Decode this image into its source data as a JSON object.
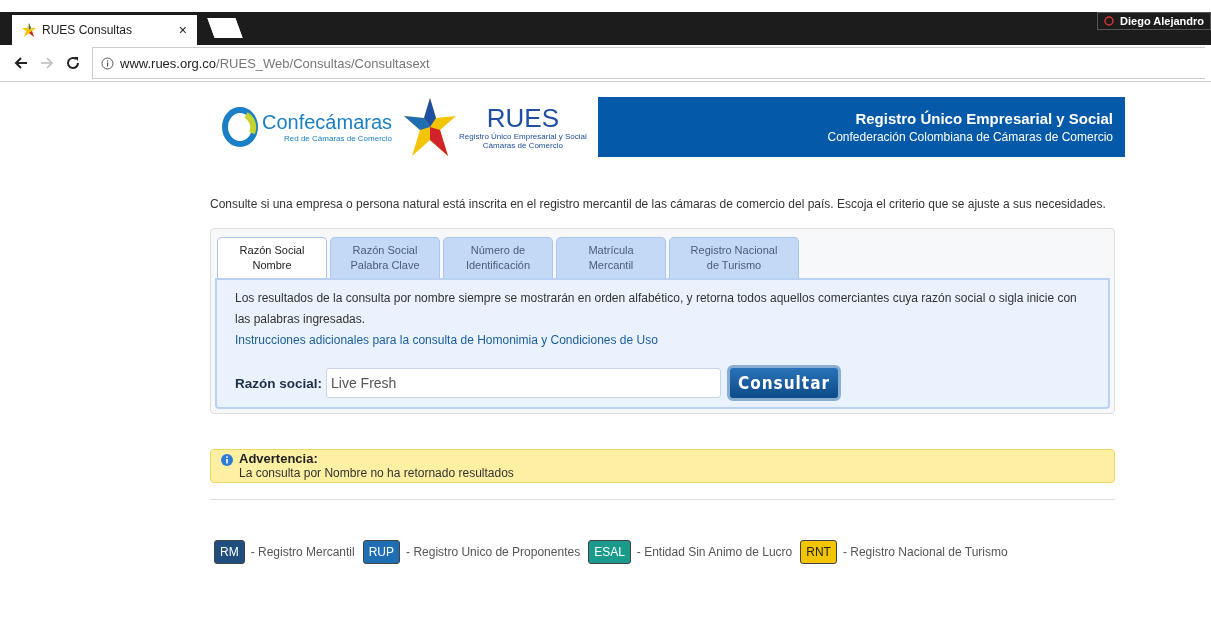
{
  "browser": {
    "tab_title": "RUES Consultas",
    "tab_close": "×",
    "profile": "Diego Alejandro",
    "url_host": "www.rues.org.co",
    "url_path": "/RUES_Web/Consultas/Consultasext"
  },
  "header": {
    "confe_name": "Confecámaras",
    "confe_sub": "Red de Cámaras de Comercio",
    "rues_name": "RUES",
    "rues_sub1": "Registro Único Empresarial y Social",
    "rues_sub2": "Cámaras de Comercio",
    "banner_title": "Registro Único Empresarial y Social",
    "banner_subtitle": "Confederación Colombiana de Cámaras de Comercio"
  },
  "intro": "Consulte si una empresa o persona natural está inscrita en el registro mercantil de las cámaras de comercio del país. Escoja el criterio que se ajuste a sus necesidades.",
  "tabs": [
    {
      "line1": "Razón Social",
      "line2": "Nombre",
      "selected": true
    },
    {
      "line1": "Razón Social",
      "line2": "Palabra Clave",
      "selected": false
    },
    {
      "line1": "Número de",
      "line2": "Identificación",
      "selected": false
    },
    {
      "line1": "Matrícula",
      "line2": "Mercantil",
      "selected": false
    },
    {
      "line1": "Registro Nacional",
      "line2": "de Turismo",
      "selected": false
    }
  ],
  "panel": {
    "description": "Los resultados de la consulta por nombre siempre se mostrarán en orden alfabético, y retorna todos aquellos comerciantes cuya razón social o sigla inicie con las palabras ingresadas.",
    "link": "Instrucciones adicionales para la consulta de Homonimia y Condiciones de Uso",
    "field_label": "Razón social:",
    "field_value": "Live Fresh",
    "button": "Consultar"
  },
  "warning": {
    "title": "Advertencia:",
    "message": "La consulta por Nombre no ha retornado resultados"
  },
  "legend": [
    {
      "badge": "RM",
      "label": "- Registro Mercantil",
      "color": "#1f4f7f"
    },
    {
      "badge": "RUP",
      "label": "- Registro Unico de Proponentes",
      "color": "#1f6db3"
    },
    {
      "badge": "ESAL",
      "label": "- Entidad Sin Animo de Lucro",
      "color": "#1a9a8a"
    },
    {
      "badge": "RNT",
      "label": "- Registro Nacional de Turismo",
      "color": "#f2c500"
    }
  ]
}
